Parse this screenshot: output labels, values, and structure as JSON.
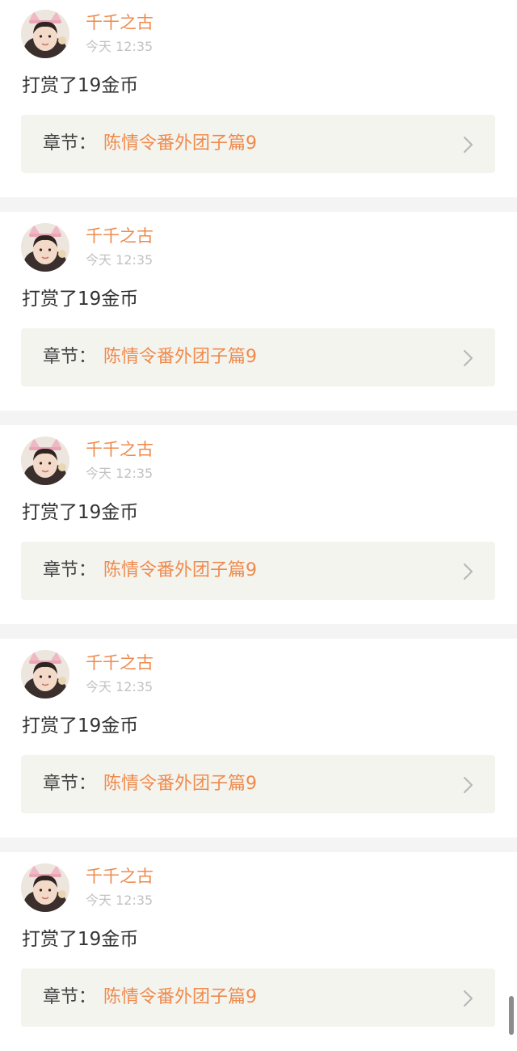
{
  "feed": {
    "items": [
      {
        "user": "千千之古",
        "time": "今天 12:35",
        "message": "打赏了19金币",
        "chapter_prefix": "章节：",
        "chapter_title": "陈情令番外团子篇9"
      },
      {
        "user": "千千之古",
        "time": "今天 12:35",
        "message": "打赏了19金币",
        "chapter_prefix": "章节：",
        "chapter_title": "陈情令番外团子篇9"
      },
      {
        "user": "千千之古",
        "time": "今天 12:35",
        "message": "打赏了19金币",
        "chapter_prefix": "章节：",
        "chapter_title": "陈情令番外团子篇9"
      },
      {
        "user": "千千之古",
        "time": "今天 12:35",
        "message": "打赏了19金币",
        "chapter_prefix": "章节：",
        "chapter_title": "陈情令番外团子篇9"
      },
      {
        "user": "千千之古",
        "time": "今天 12:35",
        "message": "打赏了19金币",
        "chapter_prefix": "章节：",
        "chapter_title": "陈情令番外团子篇9"
      }
    ]
  },
  "colors": {
    "accent": "#ef8a4c",
    "timestamp": "#c2c2c2",
    "card_background": "#f4f4ef",
    "separator": "#f4f4f4"
  },
  "icons": {
    "avatar": "avatar-photo",
    "chevron": "chevron-right-icon"
  }
}
